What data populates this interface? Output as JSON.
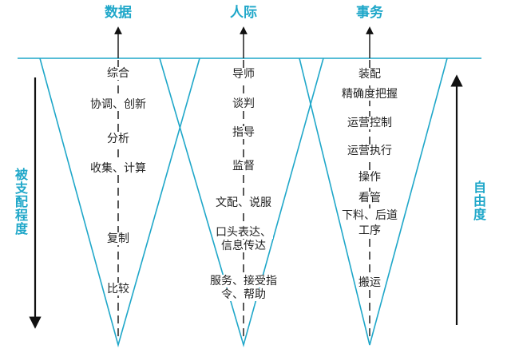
{
  "columns": [
    {
      "title": "数据",
      "items": [
        "综合",
        "协调、创新",
        "分析",
        "收集、计算",
        "复制",
        "比较"
      ]
    },
    {
      "title": "人际",
      "items": [
        "导师",
        "谈判",
        "指导",
        "监督",
        "文配、说服",
        "口头表达、",
        "信息传达",
        "服务、接受指",
        "令、帮助"
      ]
    },
    {
      "title": "事务",
      "items": [
        "装配",
        "精确度把握",
        "运营控制",
        "运营执行",
        "操作",
        "看管",
        "下料、后道",
        "工序",
        "搬运"
      ]
    }
  ],
  "left_axis_label": "被支配程度",
  "right_axis_label": "自由度",
  "colors": {
    "accent": "#1fa7c9",
    "line": "#111111",
    "text": "#222222"
  }
}
